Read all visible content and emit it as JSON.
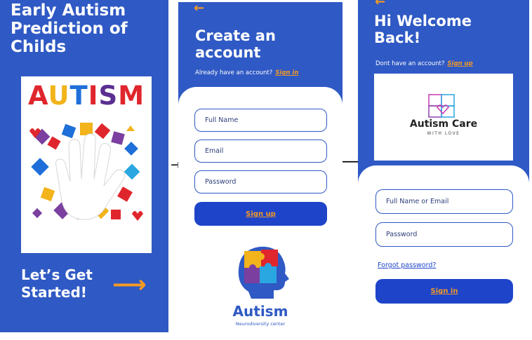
{
  "screen1": {
    "title": "Early Autism Prediction of Childs",
    "image_text": "AUTISM",
    "cta": "Let’s Get Started!",
    "cta_icon": "arrow-right-icon"
  },
  "screen2": {
    "back_icon": "arrow-left-icon",
    "title": "Create an account",
    "subtitle": "Already have an account?",
    "signin_link": "Sign in",
    "fields": [
      {
        "placeholder": "Full Name"
      },
      {
        "placeholder": "Email"
      },
      {
        "placeholder": "Password"
      }
    ],
    "signup_button": "Sign up",
    "logo_title": "Autism",
    "logo_subtitle": "Neurodiversity center"
  },
  "screen3": {
    "back_icon": "arrow-left-icon",
    "title": "Hi Welcome Back!",
    "subtitle": "Dont have an account?",
    "signup_link": "Sign up",
    "logo_title": "Autism Care",
    "logo_subtitle": "WITH LOVE",
    "fields": [
      {
        "placeholder": "Full Name or Email"
      },
      {
        "placeholder": "Password"
      }
    ],
    "forgot_link": "Forgot password?",
    "signin_button": "Sign in"
  },
  "colors": {
    "primary": "#2f59c4",
    "button": "#1e44c9",
    "accent": "#f59a23"
  },
  "flow_icons": [
    "arrow-right-icon",
    "long-arrow-right-icon"
  ]
}
